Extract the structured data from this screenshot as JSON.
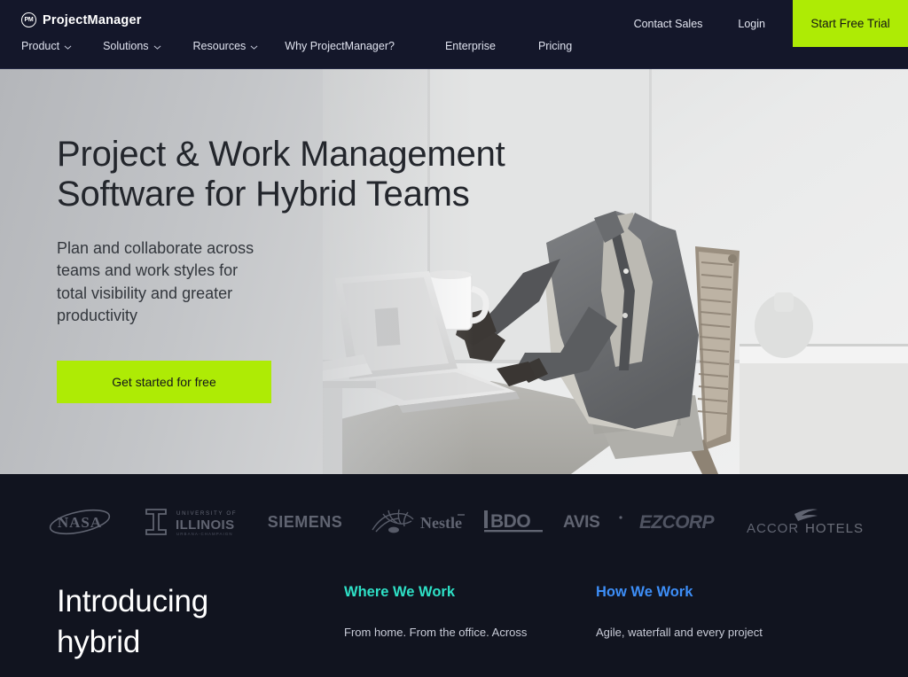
{
  "brand": {
    "name": "ProjectManager",
    "mark_initials": "PM",
    "accent_green": "#aeeb05",
    "nav_bg": "#14172a",
    "dark_bg": "#11141f"
  },
  "navbar": {
    "primary_links": [
      {
        "label": "Product",
        "icon": "chevron-down-icon",
        "has_chevron": true
      },
      {
        "label": "Solutions",
        "icon": "chevron-down-icon",
        "has_chevron": true
      },
      {
        "label": "Resources",
        "icon": "chevron-down-icon",
        "has_chevron": true
      },
      {
        "label": "Why ProjectManager?",
        "has_chevron": false
      },
      {
        "label": "Enterprise",
        "has_chevron": false
      },
      {
        "label": "Pricing",
        "has_chevron": false
      }
    ],
    "contact_sales": "Contact Sales",
    "login": "Login",
    "start_free_trial": "Start Free Trial"
  },
  "hero": {
    "title": "Project & Work Management\nSoftware for Hybrid Teams",
    "subtitle": "Plan and collaborate across\nteams and work styles for\ntotal visibility and greater\nproductivity",
    "cta_label": "Get started for free",
    "image_alt": "man-working-on-laptop-photo"
  },
  "logos": [
    {
      "name": "NASA",
      "key": "nasa"
    },
    {
      "name": "UNIVERSITY OF ILLINOIS",
      "key": "illinois",
      "sub": "URBANA-CHAMPAIGN"
    },
    {
      "name": "SIEMENS",
      "key": "siemens"
    },
    {
      "name": "Nestle",
      "key": "nestle"
    },
    {
      "name": "IBDO",
      "key": "bdo"
    },
    {
      "name": "AVIS",
      "key": "avis"
    },
    {
      "name": "EZCORP",
      "key": "ezcorp"
    },
    {
      "name": "ACCOR HOTELS",
      "key": "accorhotels"
    }
  ],
  "bottom": {
    "intro_heading": "Introducing\nhybrid",
    "columns": [
      {
        "title": "Where We Work",
        "color": "#2ee0c6",
        "body": "From home. From the office. Across"
      },
      {
        "title": "How We Work",
        "color": "#3d8ef7",
        "body": "Agile, waterfall and every project"
      }
    ]
  }
}
